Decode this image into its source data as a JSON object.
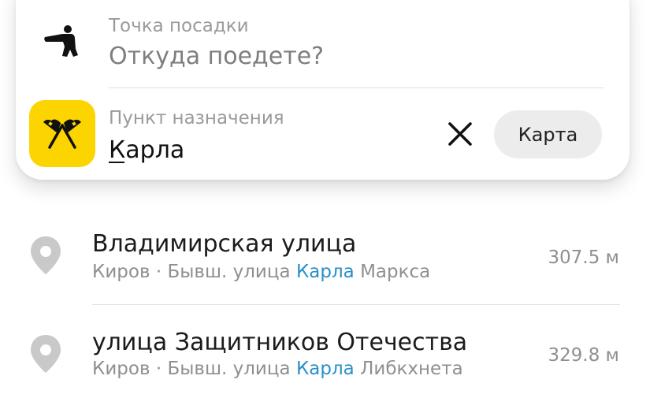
{
  "pickup": {
    "label": "Точка посадки",
    "placeholder": "Откуда поедете?",
    "icon": "pointing-person-icon"
  },
  "destination": {
    "label": "Пункт назначения",
    "value": "Карла",
    "icon": "checkered-flags-icon",
    "icon_bg": "#fcd400"
  },
  "buttons": {
    "map_label": "Карта",
    "clear_icon": "close-icon"
  },
  "results": [
    {
      "title": "Владимирская улица",
      "city": "Киров",
      "separator": "·",
      "prefix": "Бывш. улица",
      "highlight": "Карла",
      "suffix": "Маркса",
      "distance": "307.5 м",
      "icon": "location-pin-icon"
    },
    {
      "title": "улица Защитников Отечества",
      "city": "Киров",
      "separator": "·",
      "prefix": "Бывш. улица",
      "highlight": "Карла",
      "suffix": "Либкхнета",
      "distance": "329.8 м",
      "icon": "location-pin-icon"
    }
  ],
  "colors": {
    "accent_yellow": "#fcd400",
    "highlight_blue": "#2a90c8"
  }
}
